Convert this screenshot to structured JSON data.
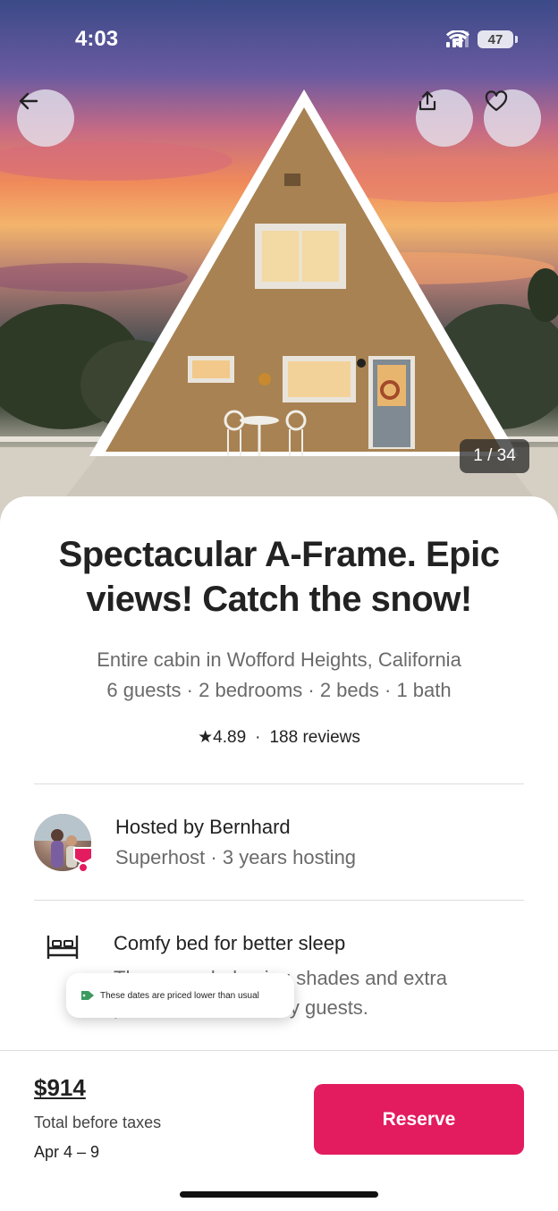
{
  "status_bar": {
    "time": "4:03",
    "battery": "47"
  },
  "hero": {
    "photo_counter": "1 / 34"
  },
  "listing": {
    "title": "Spectacular A-Frame. Epic views! Catch the snow!",
    "location": "Entire cabin in Wofford Heights, California",
    "details": "6 guests · 2 bedrooms · 2 beds · 1 bath",
    "rating_star": "★",
    "rating": "4.89",
    "rating_sep": "·",
    "reviews": "188 reviews"
  },
  "host": {
    "name": "Hosted by Bernhard",
    "subtitle": "Superhost · 3 years hosting"
  },
  "feature": {
    "title": "Comfy bed for better sleep",
    "description_line1": "The room-darkening shades and extra",
    "description_line2": "pillows were loved by guests."
  },
  "toast": {
    "text": "These dates are priced lower than usual"
  },
  "footer": {
    "price": "$914",
    "price_note": "Total before taxes",
    "dates": "Apr 4 – 9",
    "reserve_label": "Reserve"
  },
  "colors": {
    "accent": "#e31c5f",
    "toast_tag": "#3c9a5f"
  },
  "icons": {
    "back": "arrow-left-icon",
    "share": "share-icon",
    "favorite": "heart-icon",
    "bed": "bed-icon",
    "tag": "price-tag-icon"
  }
}
